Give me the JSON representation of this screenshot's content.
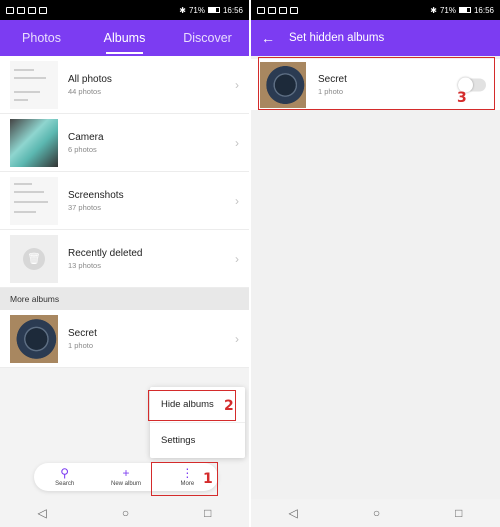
{
  "left": {
    "status": {
      "time": "16:56",
      "battery": "71%"
    },
    "tabs": [
      {
        "label": "Photos",
        "active": false
      },
      {
        "label": "Albums",
        "active": true
      },
      {
        "label": "Discover",
        "active": false
      }
    ],
    "albums": [
      {
        "name": "All photos",
        "count": "44 photos"
      },
      {
        "name": "Camera",
        "count": "6 photos"
      },
      {
        "name": "Screenshots",
        "count": "37 photos"
      },
      {
        "name": "Recently deleted",
        "count": "13 photos"
      }
    ],
    "more_albums_header": "More albums",
    "more_albums": [
      {
        "name": "Secret",
        "count": "1 photo"
      }
    ],
    "popup": {
      "hide_albums": "Hide albums",
      "settings": "Settings"
    },
    "bottom_nav": {
      "search": "Search",
      "new_album": "New album",
      "more": "More"
    },
    "annotations": {
      "one": "1",
      "two": "2"
    }
  },
  "right": {
    "status": {
      "time": "16:56",
      "battery": "71%"
    },
    "title": "Set hidden albums",
    "album": {
      "name": "Secret",
      "count": "1 photo",
      "hidden": false
    },
    "annotations": {
      "three": "3"
    }
  },
  "colors": {
    "accent": "#7c3cf2",
    "annotation": "#d42b2b"
  }
}
